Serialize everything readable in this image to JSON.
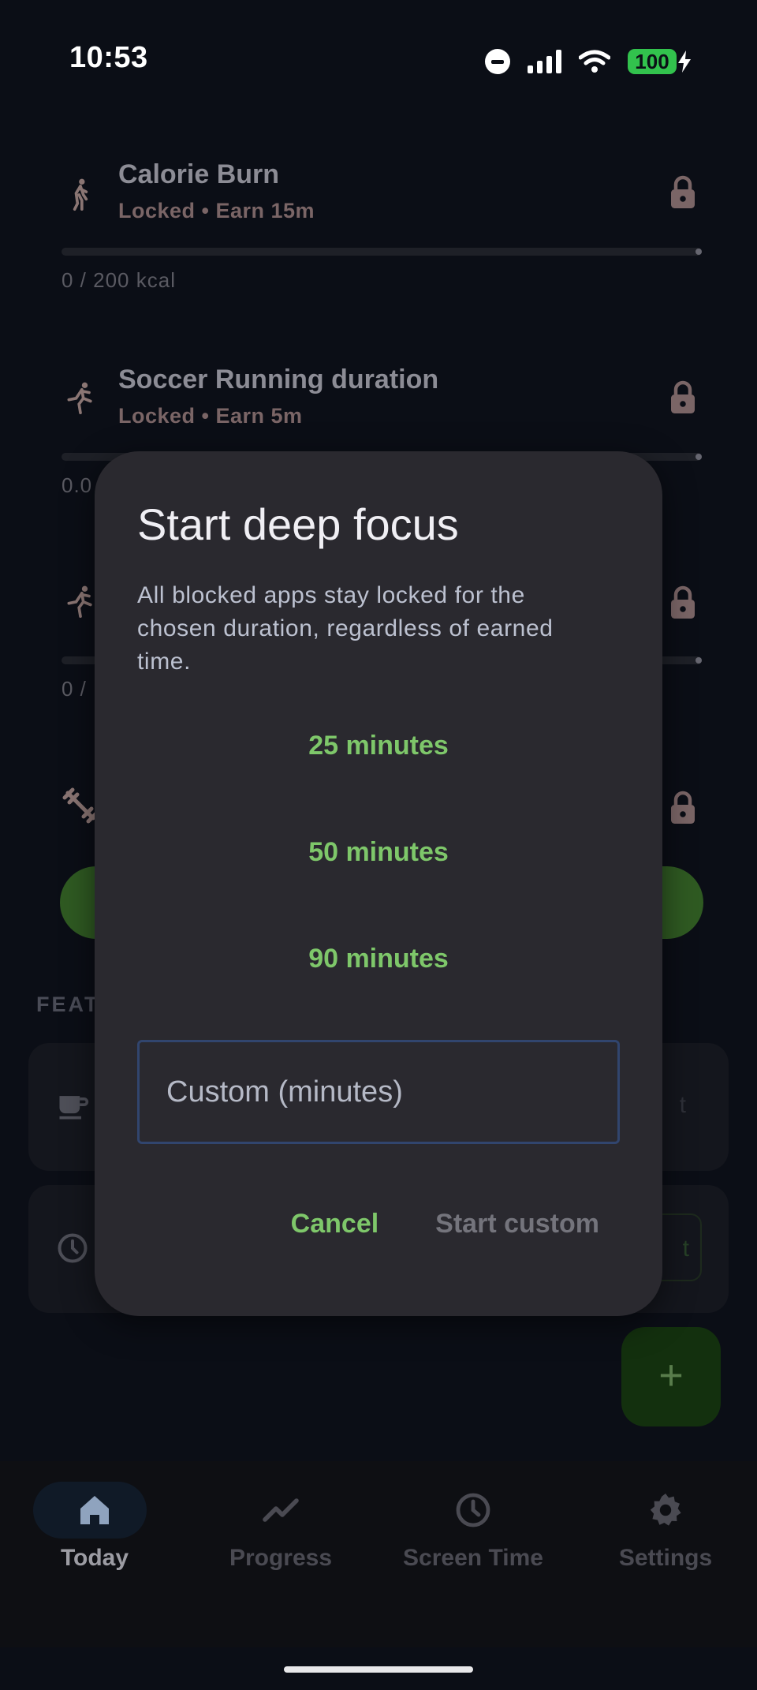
{
  "status_bar": {
    "time": "10:53",
    "battery": "100"
  },
  "goals": [
    {
      "icon": "walking-icon",
      "title": "Calorie Burn",
      "subtitle": "Locked • Earn 15m",
      "progress_text": "0 / 200 kcal",
      "progress": 0
    },
    {
      "icon": "running-icon",
      "title": "Soccer Running duration",
      "subtitle": "Locked • Earn 5m",
      "progress_text": "0.0",
      "progress": 0
    },
    {
      "icon": "running-icon",
      "title": "",
      "subtitle": "",
      "progress_text": "0 /",
      "progress": 0
    },
    {
      "icon": "dumbbell-icon",
      "title": "",
      "subtitle": "",
      "progress_text": "",
      "progress": 0
    }
  ],
  "features": {
    "label": "FEAT",
    "cards": [
      {
        "icon": "coffee-icon",
        "right_text": "t"
      },
      {
        "icon": "clock-icon",
        "right_text": "t"
      }
    ]
  },
  "fab": {
    "label": "+"
  },
  "nav": {
    "items": [
      {
        "label": "Today",
        "icon": "home-icon",
        "active": true
      },
      {
        "label": "Progress",
        "icon": "trend-icon",
        "active": false
      },
      {
        "label": "Screen Time",
        "icon": "clock-icon",
        "active": false
      },
      {
        "label": "Settings",
        "icon": "gear-icon",
        "active": false
      }
    ]
  },
  "dialog": {
    "title": "Start deep focus",
    "body": "All blocked apps stay locked for the chosen duration, regardless of earned time.",
    "options": [
      "25 minutes",
      "50 minutes",
      "90 minutes"
    ],
    "custom_placeholder": "Custom (minutes)",
    "custom_value": "",
    "cancel_label": "Cancel",
    "start_label": "Start custom"
  },
  "colors": {
    "accent_green": "#7ec76a",
    "dialog_bg": "#2a292f",
    "page_bg": "#0b0e16"
  }
}
